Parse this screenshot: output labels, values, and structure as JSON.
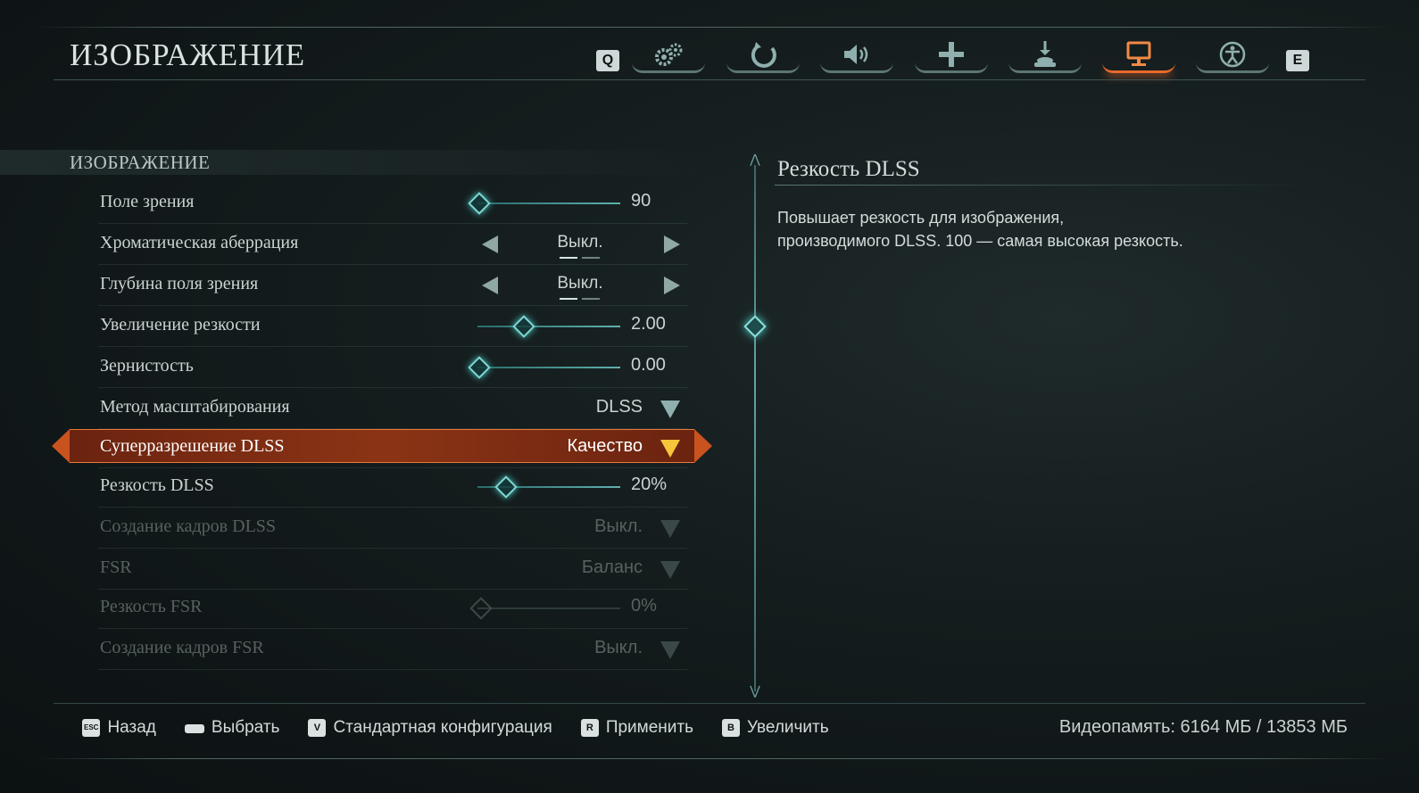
{
  "header": {
    "title": "ИЗОБРАЖЕНИЕ",
    "key_prev": "Q",
    "key_next": "E",
    "tabs": [
      {
        "icon": "gears-icon",
        "active": false
      },
      {
        "icon": "controller-icon",
        "active": false
      },
      {
        "icon": "speaker-icon",
        "active": false
      },
      {
        "icon": "dpad-icon",
        "active": false
      },
      {
        "icon": "joystick-icon",
        "active": false
      },
      {
        "icon": "monitor-icon",
        "active": true
      },
      {
        "icon": "accessibility-icon",
        "active": false
      }
    ],
    "active_tab_color": "#e86a2b"
  },
  "section": {
    "title": "ИЗОБРАЖЕНИЕ"
  },
  "settings": [
    {
      "label": "Поле зрения",
      "type": "slider",
      "value": "90",
      "level": 0.02,
      "disabled": false
    },
    {
      "label": "Хроматическая аберрация",
      "type": "toggle",
      "value": "Выкл.",
      "disabled": false
    },
    {
      "label": "Глубина поля зрения",
      "type": "toggle",
      "value": "Выкл.",
      "disabled": false
    },
    {
      "label": "Увеличение резкости",
      "type": "slider",
      "value": "2.00",
      "level": 0.33,
      "disabled": false
    },
    {
      "label": "Зернистость",
      "type": "slider",
      "value": "0.00",
      "level": 0.02,
      "disabled": false
    },
    {
      "label": "Метод масштабирования",
      "type": "dropdown",
      "value": "DLSS",
      "disabled": false
    },
    {
      "label": "Суперразрешение DLSS",
      "type": "dropdown",
      "value": "Качество",
      "disabled": false,
      "selected": true
    },
    {
      "label": "Резкость DLSS",
      "type": "slider",
      "value": "20%",
      "level": 0.2,
      "disabled": false
    },
    {
      "label": "Создание кадров DLSS",
      "type": "dropdown",
      "value": "Выкл.",
      "disabled": true
    },
    {
      "label": "FSR",
      "type": "dropdown",
      "value": "Баланс",
      "disabled": true
    },
    {
      "label": "Резкость FSR",
      "type": "slider",
      "value": "0%",
      "level": 0.02,
      "disabled": true
    },
    {
      "label": "Создание кадров FSR",
      "type": "dropdown",
      "value": "Выкл.",
      "disabled": true
    }
  ],
  "description": {
    "title": "Резкость DLSS",
    "line1": "Повышает резкость для изображения,",
    "line2": "производимого DLSS. 100 — самая высокая резкость."
  },
  "footer": {
    "back_key": "ESC",
    "back_label": "Назад",
    "select_label": "Выбрать",
    "default_key": "V",
    "default_label": "Стандартная конфигурация",
    "apply_key": "R",
    "apply_label": "Применить",
    "zoom_key": "B",
    "zoom_label": "Увеличить",
    "vram": "Видеопамять: 6164 МБ / 13853 МБ"
  }
}
